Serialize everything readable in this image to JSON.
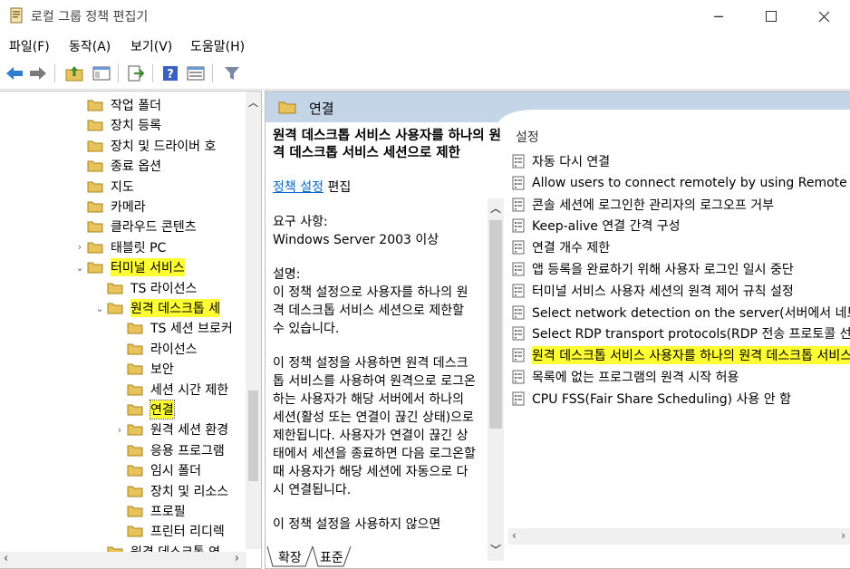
{
  "window": {
    "title": "로컬 그룹 정책 편집기"
  },
  "menu": [
    "파일(F)",
    "동작(A)",
    "보기(V)",
    "도움말(H)"
  ],
  "tree": {
    "items": [
      {
        "label": "작업 폴더",
        "level": 1,
        "arrow": ""
      },
      {
        "label": "장치 등록",
        "level": 1,
        "arrow": ""
      },
      {
        "label": "장치 및 드라이버 호",
        "level": 1,
        "arrow": ""
      },
      {
        "label": "종료 옵션",
        "level": 1,
        "arrow": ""
      },
      {
        "label": "지도",
        "level": 1,
        "arrow": ""
      },
      {
        "label": "카메라",
        "level": 1,
        "arrow": ""
      },
      {
        "label": "클라우드 콘텐츠",
        "level": 1,
        "arrow": ""
      },
      {
        "label": "태블릿 PC",
        "level": 1,
        "arrow": "›"
      },
      {
        "label": "터미널 서비스",
        "level": 1,
        "arrow": "⌄",
        "highlight": true
      },
      {
        "label": "TS 라이선스",
        "level": 2,
        "arrow": ""
      },
      {
        "label": "원격 데스크톱 세",
        "level": 2,
        "arrow": "⌄",
        "highlight": true
      },
      {
        "label": "TS 세션 브로커",
        "level": 3,
        "arrow": ""
      },
      {
        "label": "라이선스",
        "level": 3,
        "arrow": ""
      },
      {
        "label": "보안",
        "level": 3,
        "arrow": ""
      },
      {
        "label": "세션 시간 제한",
        "level": 3,
        "arrow": ""
      },
      {
        "label": "연결",
        "level": 3,
        "arrow": "",
        "highlight": true,
        "selected": true
      },
      {
        "label": "원격 세션 환경",
        "level": 3,
        "arrow": "›"
      },
      {
        "label": "응용 프로그램",
        "level": 3,
        "arrow": ""
      },
      {
        "label": "임시 폴더",
        "level": 3,
        "arrow": ""
      },
      {
        "label": "장치 및 리소스",
        "level": 3,
        "arrow": ""
      },
      {
        "label": "프로필",
        "level": 3,
        "arrow": ""
      },
      {
        "label": "프린터 리디렉",
        "level": 3,
        "arrow": ""
      },
      {
        "label": "원격 데스크톱 연",
        "level": 2,
        "arrow": ""
      }
    ]
  },
  "details": {
    "header": "연결",
    "desc_title": "원격 데스크톱 서비스 사용자를 하나의 원격 데스크톱 서비스 세션으로 제한",
    "policy_link": "정책 설정",
    "edit_label": "편집",
    "requirement_label": "요구 사항:",
    "requirement_value": "Windows Server 2003 이상",
    "desc_label": "설명:",
    "desc_p1": "이 정책 설정으로 사용자를 하나의 원격 데스크톱 서비스 세션으로 제한할 수 있습니다.",
    "desc_p2": "이 정책 설정을 사용하면 원격 데스크톱 서비스를 사용하여 원격으로 로그온하는 사용자가 해당 서버에서 하나의 세션(활성 또는 연결이 끊긴 상태)으로 제한됩니다. 사용자가 연결이 끊긴 상태에서 세션을 종료하면 다음 로그온할 때 사용자가 해당 세션에 자동으로 다시 연결됩니다.",
    "desc_p3": "이 정책 설정을 사용하지 않으면"
  },
  "list": {
    "column_header": "설정",
    "items": [
      {
        "label": "자동 다시 연결"
      },
      {
        "label": "Allow users to connect remotely by using Remote Desktop Services"
      },
      {
        "label": "콘솔 세션에 로그인한 관리자의 로그오프 거부"
      },
      {
        "label": "Keep-alive 연결 간격 구성"
      },
      {
        "label": "연결 개수 제한"
      },
      {
        "label": "앱 등록을 완료하기 위해 사용자 로그인 일시 중단"
      },
      {
        "label": "터미널 서비스 사용자 세션의 원격 제어 규칙 설정"
      },
      {
        "label": "Select network detection on the server(서버에서 네트워크 검색 선택)"
      },
      {
        "label": "Select RDP transport protocols(RDP 전송 프로토콜 선택)"
      },
      {
        "label": "원격 데스크톱 서비스 사용자를 하나의 원격 데스크톱 서비스 세션으로 제한",
        "highlight": true
      },
      {
        "label": "목록에 없는 프로그램의 원격 시작 허용"
      },
      {
        "label": "CPU FSS(Fair Share Scheduling) 사용 안 함"
      }
    ]
  },
  "tabs": [
    "확장",
    "표준"
  ],
  "colors": {
    "highlight": "#ffff33",
    "header_band": "#c5d5e8",
    "link": "#0066cc",
    "folder": "#e8c25a"
  }
}
